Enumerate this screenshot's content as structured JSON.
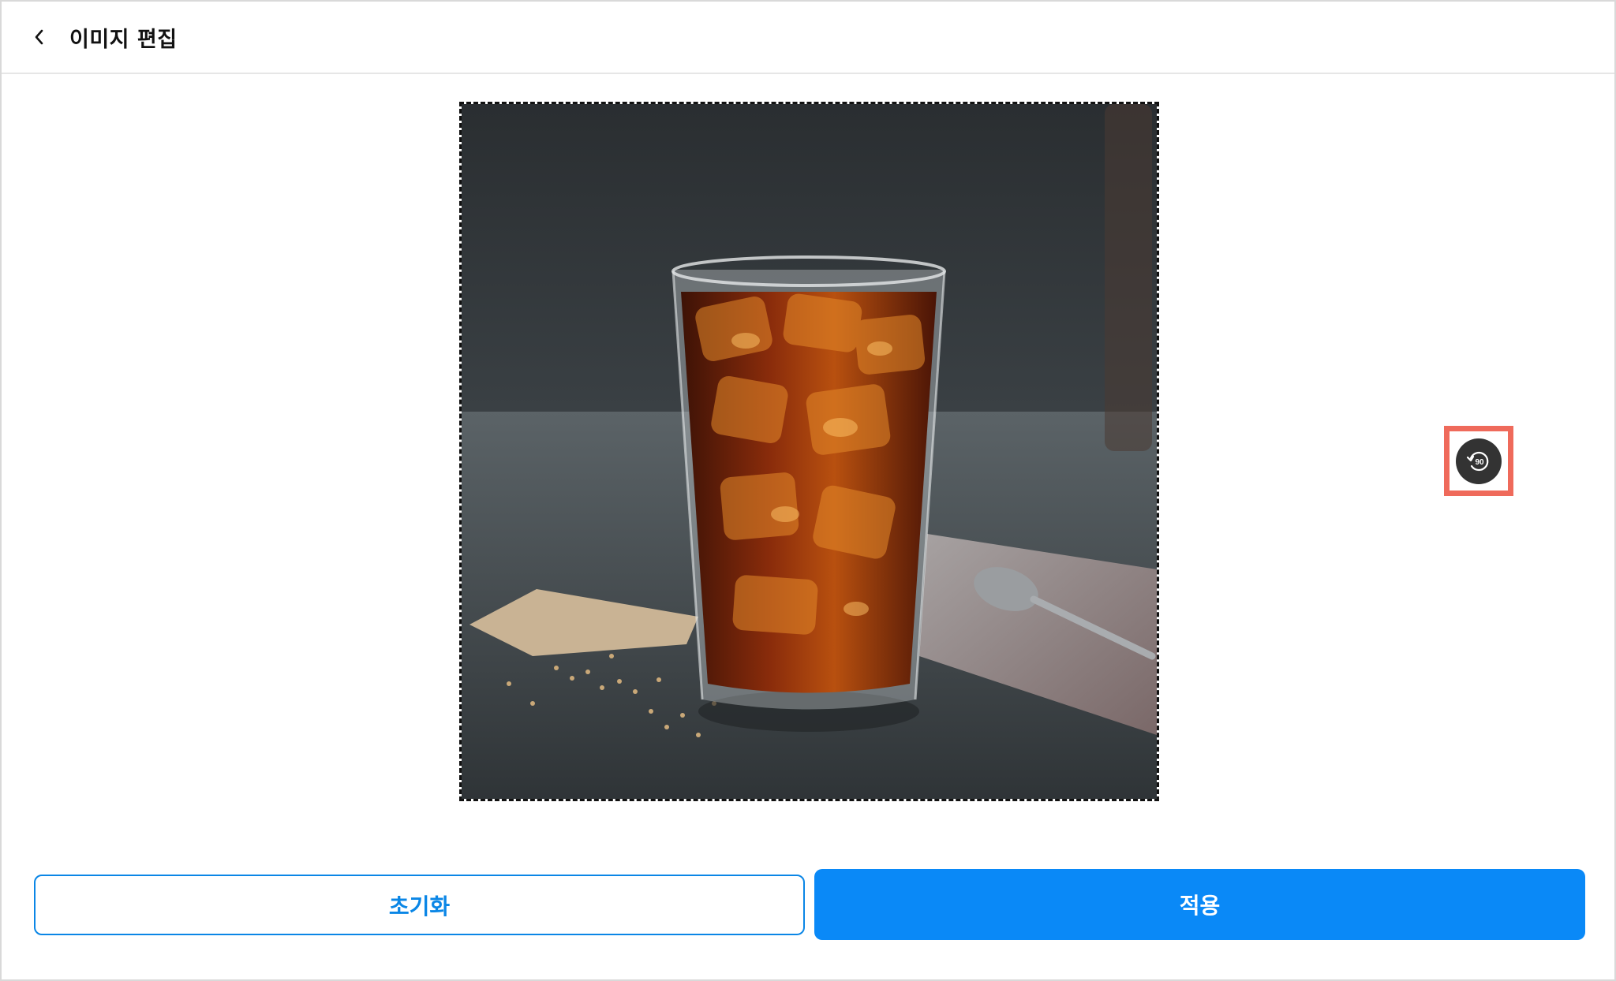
{
  "header": {
    "back_icon": "chevron-left-icon",
    "title": "이미지 편집"
  },
  "editor": {
    "image_subject": "iced-coffee-glass-photo",
    "rotate_icon": "rotate-90-icon",
    "rotate_label": "90"
  },
  "actions": {
    "reset_label": "초기화",
    "apply_label": "적용"
  },
  "colors": {
    "accent": "#0a89f7",
    "highlight": "#ef6a5b"
  }
}
